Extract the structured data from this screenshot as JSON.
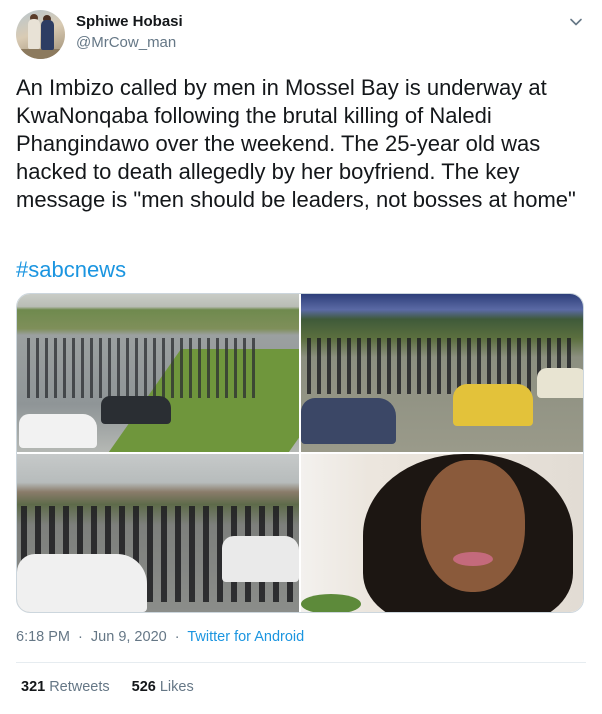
{
  "user": {
    "display_name": "Sphiwe Hobasi",
    "handle": "@MrCow_man",
    "avatar_icon": "avatar-photo"
  },
  "tweet": {
    "text": "An Imbizo called by men in Mossel Bay is underway at\nKwaNonqaba following the brutal killing of Naledi\nPhangindawo over the weekend. The 25-year old was\nhacked to death allegedly by her boyfriend. The key\nmessage is \"men should be leaders, not bosses at home\"",
    "hashtag": "#sabcnews"
  },
  "media": {
    "photos": [
      "crowd-parking-lot",
      "crowd-dusk",
      "crowd-buildings",
      "portrait"
    ]
  },
  "meta": {
    "time": "6:18 PM",
    "separator": "·",
    "date": "Jun 9, 2020",
    "source": "Twitter for Android"
  },
  "stats": {
    "retweets_count": "321",
    "retweets_label": "Retweets",
    "likes_count": "526",
    "likes_label": "Likes"
  },
  "colors": {
    "link": "#1b95e0",
    "secondary_text": "#657786",
    "primary_text": "#14171a"
  }
}
